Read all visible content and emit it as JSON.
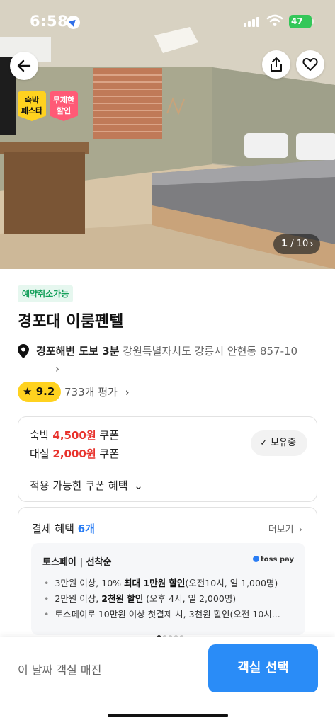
{
  "status_bar": {
    "time": "6:58",
    "battery": "47"
  },
  "hero": {
    "badges": [
      {
        "text": "숙박\n페스타",
        "color": "#ffd21f"
      },
      {
        "text": "무제한\n할인",
        "color": "#ff5a76"
      }
    ],
    "photo_counter": {
      "current": "1",
      "total": "/ 10"
    }
  },
  "listing": {
    "cancel_tag": "예약취소가능",
    "title": "경포대 이룸펜텔",
    "location_walk": "경포해변 도보 3분",
    "address": "강원특별자치도 강릉시 안현동 857-10",
    "rating": "9.2",
    "reviews": "733개 평가"
  },
  "coupons": {
    "stay_label": "숙박",
    "stay_amount": "4,500원",
    "rent_label": "대실",
    "rent_amount": "2,000원",
    "coupon_word": "쿠폰",
    "hold_button": "보유중",
    "available_label": "적용 가능한 쿠폰 혜택"
  },
  "payment": {
    "title": "결제 혜택",
    "count": "6개",
    "more": "더보기",
    "card": {
      "title": "토스페이 | 선착순",
      "logo": "toss pay",
      "bullets": [
        {
          "pre": "3만원 이상, 10% ",
          "bold": "최대 1만원 할인",
          "post": "(오전10시, 일 1,000명)"
        },
        {
          "pre": "2만원 이상, ",
          "bold": "2천원 할인",
          "post": " (오후 4시, 일 2,000명)"
        },
        {
          "pre": "토스페이로 10만원 이상 첫결제 시, 3천원 할인(오전 10시...",
          "bold": "",
          "post": ""
        }
      ]
    }
  },
  "bottom_bar": {
    "soldout": "이 날짜 객실 매진",
    "select_button": "객실 선택"
  },
  "colors": {
    "accent_blue": "#2a8cf7",
    "price_red": "#e8332d",
    "rating_yellow": "#ffd21f",
    "cancel_green": "#15a05b"
  }
}
